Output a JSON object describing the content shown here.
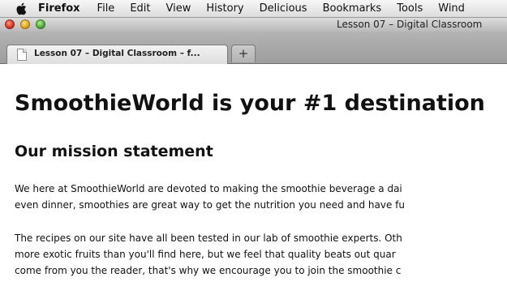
{
  "menubar": {
    "app_name": "Firefox",
    "items": [
      "File",
      "Edit",
      "View",
      "History",
      "Delicious",
      "Bookmarks",
      "Tools",
      "Wind"
    ]
  },
  "window": {
    "title": "Lesson 07 – Digital Classroom"
  },
  "tabs": {
    "active_label": "Lesson 07 – Digital Classroom – f...",
    "new_tab_symbol": "+"
  },
  "page": {
    "title": "SmoothieWorld is your #1 destination",
    "mission_heading": "Our mission statement",
    "paragraph_1": [
      "We here at SmoothieWorld are devoted to making the smoothie beverage a dai",
      "even dinner, smoothies are great way to get the nutrition you need and have fu"
    ],
    "paragraph_2": [
      "The recipes on our site have all been tested in our lab of smoothie experts. Oth",
      "more exotic fruits than you'll find here, but we feel that quality beats out quar",
      "come from you the reader, that's why we encourage you to join the smoothie c"
    ]
  },
  "icons": {
    "apple": "apple-logo-icon",
    "tab_page": "page-icon"
  }
}
